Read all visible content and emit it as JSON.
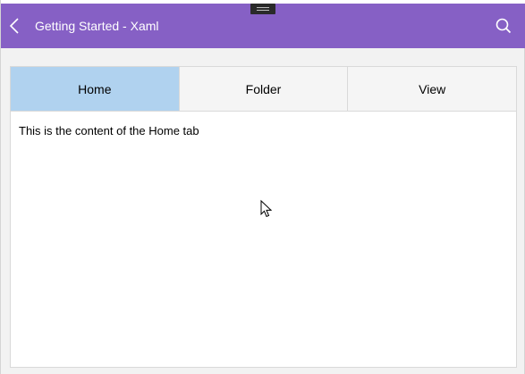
{
  "app": {
    "title": "Getting Started - Xaml"
  },
  "tabs": [
    {
      "label": "Home",
      "selected": true
    },
    {
      "label": "Folder",
      "selected": false
    },
    {
      "label": "View",
      "selected": false
    }
  ],
  "content": {
    "text": "This is the content of the Home tab"
  },
  "colors": {
    "titlebar": "#8660c5",
    "selected_tab": "#b0d2ef"
  },
  "icons": {
    "back": "chevron-left-icon",
    "search": "search-icon"
  }
}
